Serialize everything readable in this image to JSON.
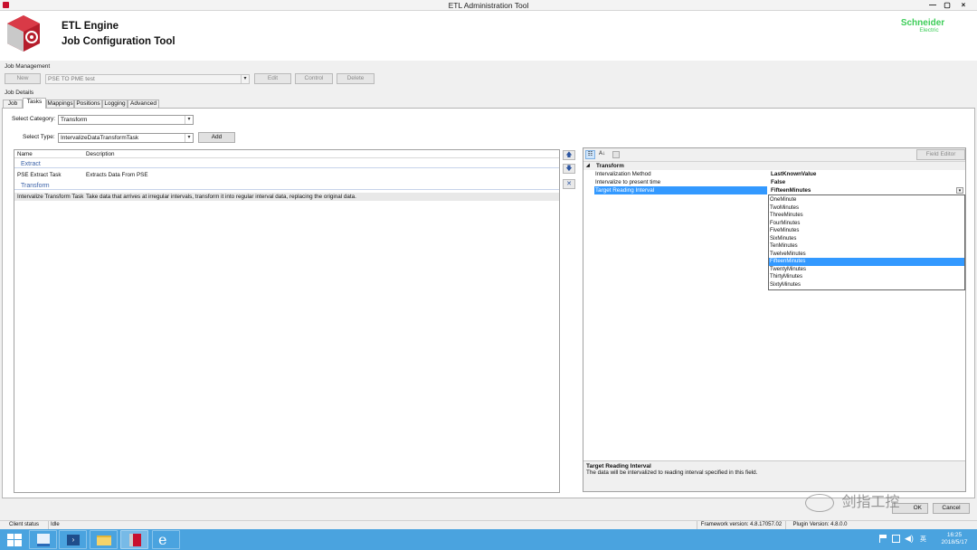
{
  "window": {
    "title": "ETL Administration Tool",
    "controls": [
      "—",
      "▢",
      "×"
    ]
  },
  "header": {
    "line1": "ETL Engine",
    "line2": "Job Configuration Tool",
    "brand_top": "Schneider",
    "brand_bottom": "Electric"
  },
  "job_management": {
    "label": "Job Management",
    "new_label": "New",
    "job_value": "PSE TO PME test",
    "edit_label": "Edit",
    "control_label": "Control",
    "delete_label": "Delete"
  },
  "job_details": {
    "label": "Job Details",
    "tabs": [
      "Job",
      "Tasks",
      "Mappings",
      "Positions",
      "Logging",
      "Advanced"
    ],
    "active_tab": "Tasks"
  },
  "tasks": {
    "category_label": "Select Category:",
    "category_value": "Transform",
    "type_label": "Select Type:",
    "type_value": "IntervalizeDataTransformTask",
    "add_label": "Add",
    "columns": [
      "Name",
      "Description"
    ],
    "groups": [
      {
        "name": "Extract",
        "rows": [
          {
            "name": "PSE Extract Task",
            "desc": "Extracts Data From PSE"
          }
        ]
      },
      {
        "name": "Transform",
        "rows": [
          {
            "name": "Intervalize Transform Task",
            "desc": "Take data that arrives at irregular intervals, transform it into regular interval data, replacing the original data."
          }
        ]
      }
    ]
  },
  "side_buttons": [
    "🡅",
    "🡇",
    "✕"
  ],
  "properties": {
    "field_editor_label": "Field Editor",
    "category": "Transform",
    "items": [
      {
        "key": "Intervalization Method",
        "value": "LastKnownValue"
      },
      {
        "key": "Intervalize to present time",
        "value": "False"
      },
      {
        "key": "Target Reading Interval",
        "value": "FifteenMinutes"
      }
    ],
    "dropdown_options": [
      "OneMinute",
      "TwoMinutes",
      "ThreeMinutes",
      "FourMinutes",
      "FiveMinutes",
      "SixMinutes",
      "TenMinutes",
      "TwelveMinutes",
      "FifteenMinutes",
      "TwentyMinutes",
      "ThirtyMinutes",
      "SixtyMinutes"
    ],
    "selected_option": "FifteenMinutes",
    "help_title": "Target Reading Interval",
    "help_text": "The data will be intervalized to reading interval specified in this field."
  },
  "footer": {
    "ok_label": "OK",
    "cancel_label": "Cancel"
  },
  "status": {
    "label": "Client status",
    "value": "Idle",
    "framework": "Framework version: 4.8.17057.02",
    "plugin": "Plugin Version: 4.8.0.0"
  },
  "watermark": "剑指工控",
  "taskbar": {
    "time": "16:25",
    "date": "2018/5/17",
    "ime": "英"
  },
  "colors": {
    "taskbar": "#4aa3df",
    "selection": "#3399ff",
    "group_text": "#3b62a9",
    "logo": "#c8102e",
    "brand": "#3dcd58"
  }
}
